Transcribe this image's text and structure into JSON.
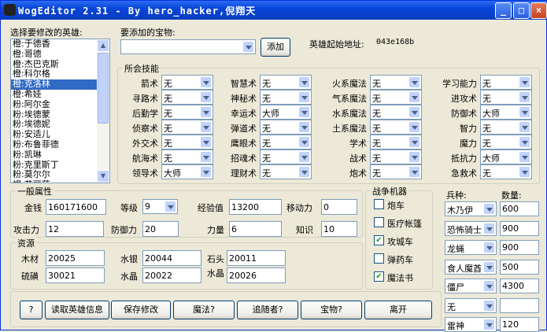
{
  "window": {
    "title": "WogEditor 2.31 - By  hero_hacker,倪翔天",
    "min": "_",
    "max": "□",
    "close": "×"
  },
  "hero_list": {
    "label": "选择要修改的英雄:",
    "items": [
      "橙:于德香",
      "橙:哥德",
      "橙:杰巴克斯",
      "橙:科尔格",
      "橙:克洛林",
      "橙:希娃",
      "粉:阿尔金",
      "粉:埃德蒙",
      "粉:埃德妮",
      "粉:安适儿",
      "粉:布鲁菲德",
      "粉:凯琳",
      "粉:克里斯丁",
      "粉:莫尔尔",
      "褐:艾丽莎"
    ],
    "selected": 4
  },
  "treasure": {
    "label": "要添加的宝物:",
    "value": "",
    "add_button": "添加"
  },
  "address": {
    "label": "英雄起始地址:",
    "value": "043e168b"
  },
  "skills": {
    "title": "所会技能",
    "columns": [
      [
        {
          "name": "箭术",
          "value": "无"
        },
        {
          "name": "寻路术",
          "value": "无"
        },
        {
          "name": "后勤学",
          "value": "无"
        },
        {
          "name": "侦察术",
          "value": "无"
        },
        {
          "name": "外交术",
          "value": "无"
        },
        {
          "name": "航海术",
          "value": "无"
        },
        {
          "name": "领导术",
          "value": "大师"
        }
      ],
      [
        {
          "name": "智慧术",
          "value": "无"
        },
        {
          "name": "神秘术",
          "value": "无"
        },
        {
          "name": "幸运术",
          "value": "大师"
        },
        {
          "name": "弹道术",
          "value": "无"
        },
        {
          "name": "鹰眼术",
          "value": "无"
        },
        {
          "name": "招魂术",
          "value": "无"
        },
        {
          "name": "理财术",
          "value": "无"
        }
      ],
      [
        {
          "name": "火系魔法",
          "value": "无"
        },
        {
          "name": "气系魔法",
          "value": "无"
        },
        {
          "name": "水系魔法",
          "value": "无"
        },
        {
          "name": "土系魔法",
          "value": "无"
        },
        {
          "name": "学术",
          "value": "无"
        },
        {
          "name": "战术",
          "value": "无"
        },
        {
          "name": "炮术",
          "value": "无"
        }
      ],
      [
        {
          "name": "学习能力",
          "value": "无"
        },
        {
          "name": "进攻术",
          "value": "无"
        },
        {
          "name": "防御术",
          "value": "大师"
        },
        {
          "name": "智力",
          "value": "无"
        },
        {
          "name": "魔力",
          "value": "无"
        },
        {
          "name": "抵抗力",
          "value": "大师"
        },
        {
          "name": "急救术",
          "value": "无"
        }
      ]
    ]
  },
  "general": {
    "title": "一般属性",
    "gold_label": "金钱",
    "gold": "160171600",
    "level_label": "等级",
    "level": "9",
    "exp_label": "经验值",
    "exp": "13200",
    "move_label": "移动力",
    "move": "0",
    "attack_label": "攻击力",
    "attack": "12",
    "defense_label": "防御力",
    "defense": "20",
    "power_label": "力量",
    "power": "6",
    "knowledge_label": "知识",
    "knowledge": "10"
  },
  "resources": {
    "title": "资源",
    "wood_label": "木材",
    "wood": "20025",
    "mercury_label": "水银",
    "mercury": "20044",
    "ore_label": "石头",
    "ore": "20011",
    "sulfur_label": "硫磺",
    "sulfur": "30021",
    "crystal_label": "水晶",
    "crystal": "20022",
    "gems_label": "水晶",
    "gems": "20026"
  },
  "war_machines": {
    "title": "战争机器",
    "items": [
      {
        "label": "炮车",
        "checked": false
      },
      {
        "label": "医疗帐篷",
        "checked": false
      },
      {
        "label": "攻城车",
        "checked": true
      },
      {
        "label": "弹药车",
        "checked": false
      },
      {
        "label": "魔法书",
        "checked": true
      }
    ]
  },
  "troops": {
    "type_label": "兵种:",
    "count_label": "数量:",
    "rows": [
      {
        "type": "木乃伊",
        "count": "600"
      },
      {
        "type": "恐怖骑士",
        "count": "900"
      },
      {
        "type": "龙蝇",
        "count": "900"
      },
      {
        "type": "食人魔酋",
        "count": "500"
      },
      {
        "type": "僵尸",
        "count": "4300"
      },
      {
        "type": "无",
        "count": ""
      },
      {
        "type": "雷神",
        "count": "120"
      }
    ]
  },
  "buttons": {
    "help": "?",
    "read": "读取英雄信息",
    "save": "保存修改",
    "magic": "魔法?",
    "follower": "追随者?",
    "treasure": "宝物?",
    "exit": "离开"
  }
}
